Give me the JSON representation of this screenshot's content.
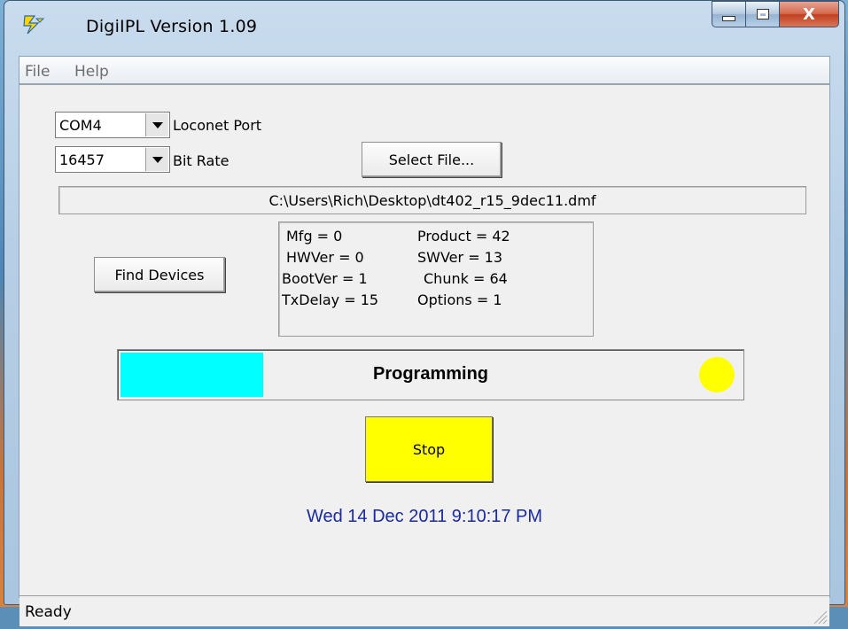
{
  "window": {
    "title": "DigiIPL  Version 1.09",
    "close_glyph": "X"
  },
  "menu": {
    "items": [
      "File",
      "Help"
    ]
  },
  "port": {
    "value": "COM4",
    "label": "Loconet Port"
  },
  "bitrate": {
    "value": "16457",
    "label": "Bit Rate"
  },
  "buttons": {
    "select_file": "Select File...",
    "find_devices": "Find Devices",
    "stop": "Stop"
  },
  "file_path": "C:\\Users\\Rich\\Desktop\\dt402_r15_9dec11.dmf",
  "device_info": {
    "mfg": "Mfg = 0",
    "product": "Product = 42",
    "hwver": "HWVer = 0",
    "swver": "SWVer = 13",
    "bootver": "BootVer = 1",
    "chunk": "Chunk = 64",
    "txdelay": "TxDelay = 15",
    "options": "Options = 1"
  },
  "progress": {
    "label": "Programming",
    "fraction": 0.23,
    "fill_color": "#00ffff",
    "indicator_color": "#ffff00"
  },
  "stop_color": "#ffff00",
  "datetime": {
    "text": "Wed 14 Dec 2011  9:10:17 PM",
    "color": "#1a2aa0"
  },
  "status": {
    "text": "Ready"
  },
  "icons": {
    "app": "lightning-bolt-icon",
    "dropdown": "chevron-down-icon",
    "grip": "resize-grip-icon"
  }
}
